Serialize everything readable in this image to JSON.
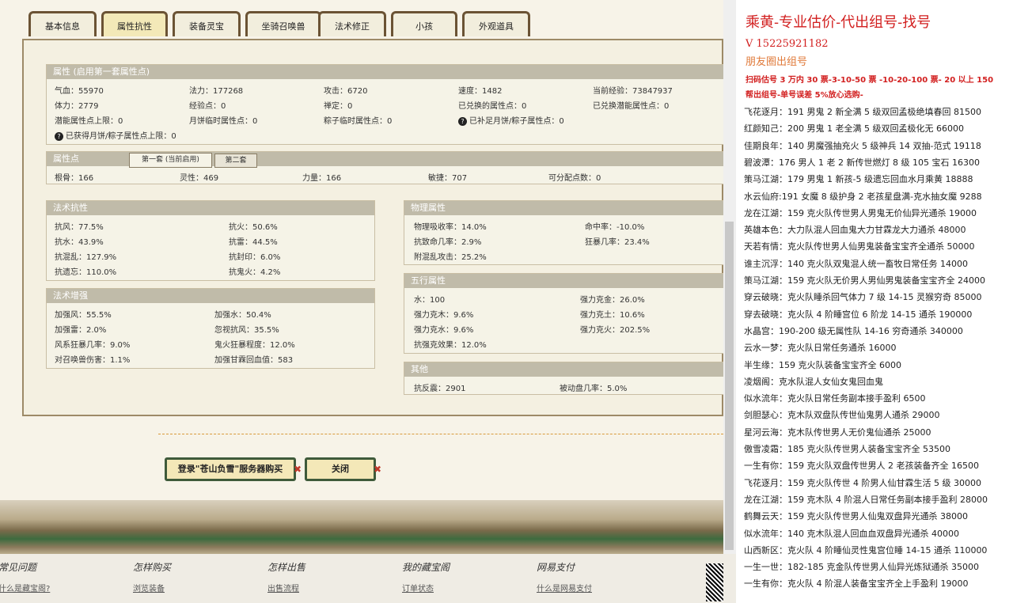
{
  "tabs": [
    "基本信息",
    "属性抗性",
    "装备灵宝",
    "坐骑召唤兽",
    "法术修正",
    "小孩",
    "外观道具"
  ],
  "attr": {
    "header": "属性 (启用第一套属性点)",
    "cells": [
      "气血：55970",
      "法力：177268",
      "攻击：6720",
      "速度：1482",
      "当前经验：73847937",
      "体力：2779",
      "经验点：0",
      "禅定：0",
      "已兑换的属性点：0",
      "已兑换潜能属性点：0",
      "潜能属性点上限：0",
      "月饼临时属性点：0",
      "粽子临时属性点：0",
      "已补足月饼/粽子属性点：0",
      "已获得月饼/粽子属性点上限：0"
    ]
  },
  "points": {
    "header": "属性点",
    "tab1": "第一套 (当前启用)",
    "tab2": "第二套",
    "cells": [
      "根骨：166",
      "灵性：469",
      "力量：166",
      "敏捷：707",
      "可分配点数：0"
    ]
  },
  "resist": {
    "header": "法术抗性",
    "cells": [
      "抗风：77.5%",
      "抗火：50.6%",
      "抗水：43.9%",
      "抗雷：44.5%",
      "抗混乱：127.9%",
      "抗封印：6.0%",
      "抗遗忘：110.0%",
      "抗鬼火：4.2%"
    ]
  },
  "enhance": {
    "header": "法术增强",
    "cells": [
      "加强风：55.5%",
      "加强水：50.4%",
      "加强雷：2.0%",
      "忽视抗风：35.5%",
      "风系狂暴几率：9.0%",
      "鬼火狂暴程度：12.0%",
      "对召唤兽伤害：1.1%",
      "加强甘霖回血值：583"
    ]
  },
  "physical": {
    "header": "物理属性",
    "cells": [
      "物理吸收率：14.0%",
      "命中率：-10.0%",
      "抗致命几率：2.9%",
      "狂暴几率：23.4%",
      "附混乱攻击：25.2%"
    ]
  },
  "wuxing": {
    "header": "五行属性",
    "cells": [
      "水：100",
      "强力克金：26.0%",
      "强力克木：9.6%",
      "强力克土：10.6%",
      "强力克水：9.6%",
      "强力克火：202.5%",
      "抗强克效果：12.0%"
    ]
  },
  "other": {
    "header": "其他",
    "cells": [
      "抗反震：2901",
      "被动盘几率：5.0%"
    ]
  },
  "buttons": {
    "buy": "登录\"苍山负雪\"服务器购买",
    "close": "关闭"
  },
  "footer": [
    {
      "title": "常见问题",
      "link": "什么是藏宝阁?"
    },
    {
      "title": "怎样购买",
      "link": "浏览装备"
    },
    {
      "title": "怎样出售",
      "link": "出售流程"
    },
    {
      "title": "我的藏宝阁",
      "link": "订单状态"
    },
    {
      "title": "网易支付",
      "link": "什么是网易支付"
    }
  ],
  "right": {
    "title": "乘黄-专业估价-代出组号-找号",
    "phone": "V 15225921182",
    "circle": "朋友圈出组号",
    "price1": "扫码估号 3 万内 30 票-3-10-50 票 -10-20-100 票- 20 以上 150",
    "price2": "帮出组号-单号误差 5%放心选购-",
    "lines": [
      "飞花逐月：191 男鬼 2 新全满 5 级双回孟极绝填春回 81500",
      "红颜知己：200 男鬼 1 老全满 5 级双回孟极化无 66000",
      "佳期良年：140 男魔强抽充火 5 级神兵 14 双抽-范式 19118",
      "碧波潭：176 男人 1 老 2 新传世燃灯 8 级 105 宝石 16300",
      "策马江湖：179 男鬼 1 新孩-5 级遗忘回血水月乘黄 18888",
      "水云仙府:191 女魔 8 级护身 2 老孩星盘满-克水抽女魔 9288",
      "龙在江湖：159 克火队传世男人男鬼无价仙异光通杀 19000",
      "英雄本色：大力队混人回血鬼大力甘霖龙大力通杀 48000",
      "天若有情：克火队传世男人仙男鬼装备宝宝齐全通杀 50000",
      "谁主沉浮：140 克火队双鬼混人统一畜牧日常任务 14000",
      "策马江湖：159 克火队无价男人男仙男鬼装备宝宝齐全 24000",
      "穿云破晓：克火队睡杀回气体力 7 级 14-15 灵猴穷奇 85000",
      "穿去破晓：克火队 4 阶睡宫位 6 阶龙 14-15 通杀 190000",
      "水晶宫：190-200 级无属性队 14-16 穷奇通杀 340000",
      "云水一梦：克火队日常任务通杀 16000",
      "半生缘：159 克火队装备宝宝齐全 6000",
      "凌烟阁：克水队混人女仙女鬼回血鬼",
      "似水流年：克火队日常任务副本接手盈利 6500",
      "剑胆瑟心：克木队双盘队传世仙鬼男人通杀 29000",
      "星河云海：克木队传世男人无价鬼仙通杀 25000",
      "傲雪凌霜：185 克火队传世男人装备宝宝齐全 53500",
      "一生有你：159 克火队双盘传世男人 2 老孩装备齐全 16500",
      "飞花逐月：159 克火队传世 4 阶男人仙甘霖生活 5 级 30000",
      "龙在江湖：159 克木队 4 阶混人日常任务副本接手盈利 28000",
      "鹤舞云天：159 克火队传世男人仙鬼双盘异光通杀 38000",
      "似水流年：140 克木队混人回血血双盘异光通杀 40000",
      "山西新区：克火队 4 阶睡仙灵性鬼宫位睡 14-15 通杀 110000",
      "一生一世：182-185 克金队传世男人仙异光炼狱通杀 35000",
      "一生有你：克火队 4 阶混人装备宝宝齐全上手盈利 19000"
    ]
  }
}
